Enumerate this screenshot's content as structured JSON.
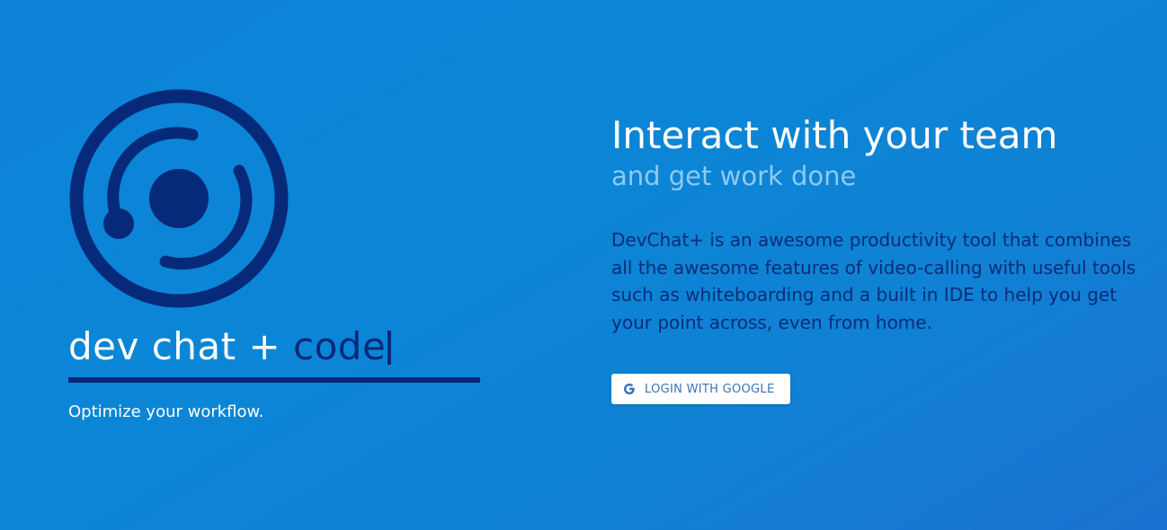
{
  "brand": {
    "wordmark_primary": "dev chat + ",
    "wordmark_accent": "code",
    "tagline": "Optimize your workflow."
  },
  "hero": {
    "headline": "Interact with your team",
    "subheadline": "and get work done",
    "description": "DevChat+ is an awesome productivity tool that combines all the awesome features of video-calling with useful tools such as whiteboarding and a built in IDE to help you get your point across, even from home."
  },
  "actions": {
    "google_login_label": "LOGIN WITH GOOGLE",
    "google_icon": "google-g-icon"
  },
  "colors": {
    "background": "#0b86d6",
    "brand_dark": "#062a79",
    "subheadline": "#8fc9f2",
    "button_text": "#3a73b8"
  }
}
